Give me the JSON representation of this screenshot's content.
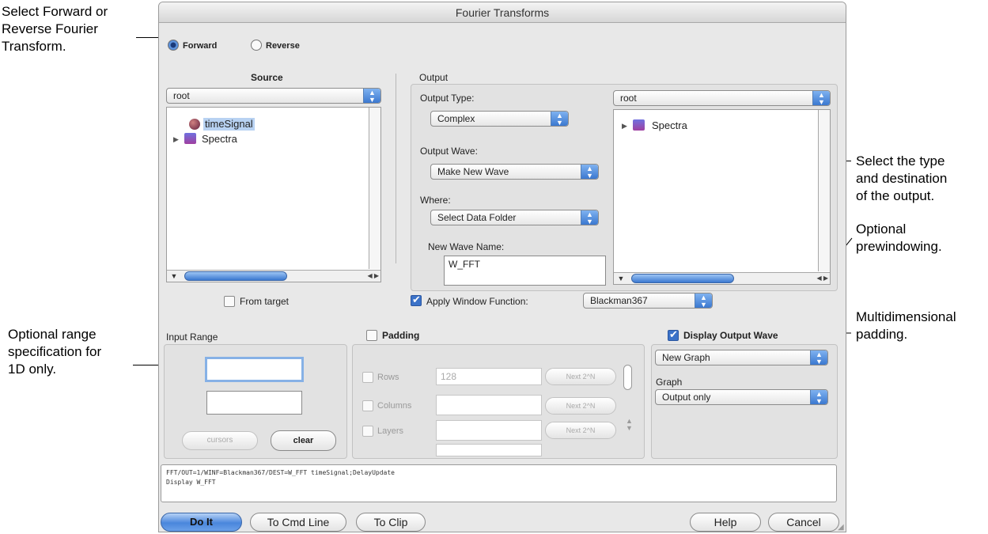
{
  "annotations": {
    "direction_lines": [
      "Select Forward or",
      "Reverse Fourier",
      "Transform."
    ],
    "output_lines": [
      "Select the type",
      "and destination",
      "of the output."
    ],
    "prewindow_lines": [
      "Optional",
      "prewindowing."
    ],
    "padding_lines": [
      "Multidimensional",
      "padding."
    ],
    "range_lines": [
      "Optional range",
      "specification for",
      "1D only."
    ]
  },
  "dialog": {
    "title": "Fourier Transforms",
    "direction": {
      "forward_label": "Forward",
      "reverse_label": "Reverse",
      "selected": "Forward"
    },
    "source": {
      "header": "Source",
      "folder": "root",
      "items": [
        {
          "label": "timeSignal",
          "icon": "wave-icon",
          "selected": true
        },
        {
          "label": "Spectra",
          "icon": "folder-icon",
          "expandable": true
        }
      ],
      "from_target_label": "From target"
    },
    "output": {
      "header": "Output",
      "type_label": "Output Type:",
      "type_value": "Complex",
      "wave_label": "Output Wave:",
      "wave_value": "Make New Wave",
      "where_label": "Where:",
      "where_value": "Select Data Folder",
      "name_label": "New Wave Name:",
      "name_value": "W_FFT",
      "dest_folder": "root",
      "dest_items": [
        {
          "label": "Spectra",
          "icon": "folder-icon",
          "expandable": true
        }
      ]
    },
    "window_function": {
      "label": "Apply Window Function:",
      "checked": true,
      "value": "Blackman367"
    },
    "input_range": {
      "header": "Input Range",
      "start_value": "",
      "end_value": "",
      "cursors_label": "cursors",
      "clear_label": "clear"
    },
    "padding": {
      "label": "Padding",
      "checked": false,
      "rows": [
        {
          "label": "Rows",
          "value": "128",
          "button": "Next 2^N"
        },
        {
          "label": "Columns",
          "value": "",
          "button": "Next 2^N"
        },
        {
          "label": "Layers",
          "value": "",
          "button": "Next 2^N"
        }
      ]
    },
    "display": {
      "label": "Display Output Wave",
      "checked": true,
      "mode": "New Graph",
      "graph_label": "Graph",
      "graph_value": "Output only"
    },
    "command_lines": [
      "FFT/OUT=1/WINF=Blackman367/DEST=W_FFT timeSignal;DelayUpdate",
      "Display W_FFT"
    ],
    "buttons": {
      "do_it": "Do It",
      "to_cmd": "To Cmd Line",
      "to_clip": "To Clip",
      "help": "Help",
      "cancel": "Cancel"
    }
  },
  "colors": {
    "accent": "#3b78d0",
    "dialog_bg": "#e8e8e8",
    "selection": "#b8d2f2"
  }
}
